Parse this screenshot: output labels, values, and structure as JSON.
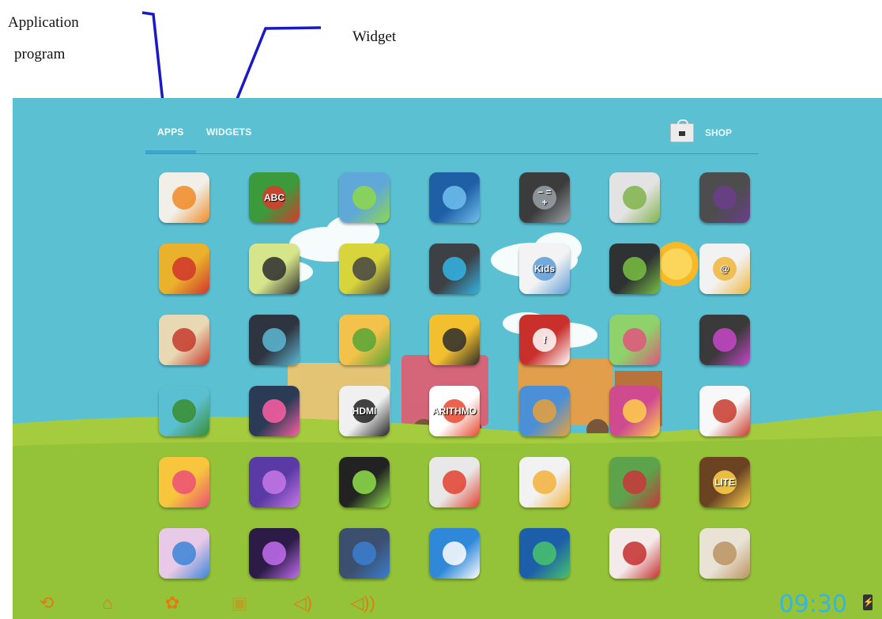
{
  "annotations": {
    "application_line1": "Application",
    "application_line2": "program",
    "widget": "Widget"
  },
  "tabs": {
    "apps": "APPS",
    "widgets": "WIDGETS",
    "shop": "SHOP"
  },
  "apps": [
    {
      "name": "app-store-icon",
      "color": "#f1efe8",
      "accent": "#f08a24",
      "label": ""
    },
    {
      "name": "abc-kids-icon",
      "color": "#3b9a3c",
      "accent": "#d9392d",
      "label": "ABC"
    },
    {
      "name": "android-gift-icon",
      "color": "#5fa8d8",
      "accent": "#8ed84a",
      "label": ""
    },
    {
      "name": "browser-globe-icon",
      "color": "#1f5fa6",
      "accent": "#70c1ee",
      "label": ""
    },
    {
      "name": "calculator-icon",
      "color": "#3c3c3c",
      "accent": "#9aa2a8",
      "label": "− =\n+"
    },
    {
      "name": "calendar-icon",
      "color": "#e3e3e3",
      "accent": "#7fb34a",
      "label": ""
    },
    {
      "name": "camera-icon",
      "color": "#4d4d4d",
      "accent": "#6c3d8d",
      "label": ""
    },
    {
      "name": "cat-game-icon",
      "color": "#e9b12c",
      "accent": "#d0352c",
      "label": ""
    },
    {
      "name": "girl-avatar-icon",
      "color": "#d7e58a",
      "accent": "#2d2d2d",
      "label": ""
    },
    {
      "name": "bird-icon",
      "color": "#d7d43c",
      "accent": "#444",
      "label": ""
    },
    {
      "name": "clock-icon",
      "color": "#3d4146",
      "accent": "#33b5e5",
      "label": ""
    },
    {
      "name": "kids-coloring-icon",
      "color": "#f3f3f3",
      "accent": "#5d9bd6",
      "label": "Kids"
    },
    {
      "name": "download-icon",
      "color": "#2e3233",
      "accent": "#79c142",
      "label": ""
    },
    {
      "name": "email-icon",
      "color": "#f2f2f2",
      "accent": "#f0b63b",
      "label": "@"
    },
    {
      "name": "book-icon",
      "color": "#e8d8b4",
      "accent": "#c63a2b",
      "label": ""
    },
    {
      "name": "camera-lite-icon",
      "color": "#2f3540",
      "accent": "#5db9d6",
      "label": ""
    },
    {
      "name": "file-manager-icon",
      "color": "#f3c24a",
      "accent": "#55a637",
      "label": ""
    },
    {
      "name": "fish-icon",
      "color": "#f2c02e",
      "accent": "#2b2b2b",
      "label": ""
    },
    {
      "name": "flash-icon",
      "color": "#c9302c",
      "accent": "#ffffff",
      "label": "f"
    },
    {
      "name": "frogs-icon",
      "color": "#8fd16a",
      "accent": "#e0557c",
      "label": ""
    },
    {
      "name": "gallery-icon",
      "color": "#3a3a3a",
      "accent": "#c846c9",
      "label": ""
    },
    {
      "name": "tree-icon",
      "color": "#5bbfd2",
      "accent": "#3a8d2e",
      "label": ""
    },
    {
      "name": "bubbles-game-icon",
      "color": "#2b3b55",
      "accent": "#ff5fa5",
      "label": ""
    },
    {
      "name": "hdmi-icon",
      "color": "#f0f0f0",
      "accent": "#222",
      "label": "HDMI"
    },
    {
      "name": "arithmo-icon",
      "color": "#ffffff",
      "accent": "#e8462e",
      "label": "ARITHMO"
    },
    {
      "name": "mouse-game-icon",
      "color": "#4b8fd6",
      "accent": "#e9a13a",
      "label": ""
    },
    {
      "name": "baby-balloons-icon",
      "color": "#d04a8f",
      "accent": "#ffd04a",
      "label": ""
    },
    {
      "name": "airplanes-icon",
      "color": "#f8f8f8",
      "accent": "#c83a2b",
      "label": ""
    },
    {
      "name": "bear-icon",
      "color": "#f7c63d",
      "accent": "#ec4d75",
      "label": ""
    },
    {
      "name": "fish-purple-icon",
      "color": "#5a3aa5",
      "accent": "#c878e8",
      "label": ""
    },
    {
      "name": "kids-karaoke-icon",
      "color": "#222",
      "accent": "#8fe14a",
      "label": ""
    },
    {
      "name": "paint-icon",
      "color": "#e8e8e8",
      "accent": "#e2412f",
      "label": ""
    },
    {
      "name": "piano-icon",
      "color": "#f2f2f2",
      "accent": "#f3b13a",
      "label": ""
    },
    {
      "name": "kids-faces-icon",
      "color": "#5da34c",
      "accent": "#c9363a",
      "label": ""
    },
    {
      "name": "owl-lite-icon",
      "color": "#6b4323",
      "accent": "#ffd24a",
      "label": "LITE"
    },
    {
      "name": "alphabet-blocks-icon",
      "color": "#e8c9e8",
      "accent": "#3b84d6",
      "label": ""
    },
    {
      "name": "video-icon",
      "color": "#2c1b47",
      "accent": "#c36ff0",
      "label": ""
    },
    {
      "name": "speaker-icon",
      "color": "#3d4f6e",
      "accent": "#3a7fd0",
      "label": ""
    },
    {
      "name": "origami-crane-icon",
      "color": "#2f88d8",
      "accent": "#ffffff",
      "label": ""
    },
    {
      "name": "sync-icon",
      "color": "#1c5fa8",
      "accent": "#49c46c",
      "label": ""
    },
    {
      "name": "tic-tac-icon",
      "color": "#f5eaea",
      "accent": "#c42e2e",
      "label": ""
    },
    {
      "name": "puppy-icon",
      "color": "#e9e3d6",
      "accent": "#bb9360",
      "label": ""
    }
  ],
  "navbar": {
    "buttons": [
      {
        "name": "back-button",
        "glyph": "⟲"
      },
      {
        "name": "home-button",
        "glyph": "⌂"
      },
      {
        "name": "recent-apps-button",
        "glyph": "✿"
      },
      {
        "name": "screenshot-button",
        "glyph": "▣"
      },
      {
        "name": "volume-down-button",
        "glyph": "◁)"
      },
      {
        "name": "volume-up-button",
        "glyph": "◁))"
      }
    ],
    "time": "09:30"
  }
}
